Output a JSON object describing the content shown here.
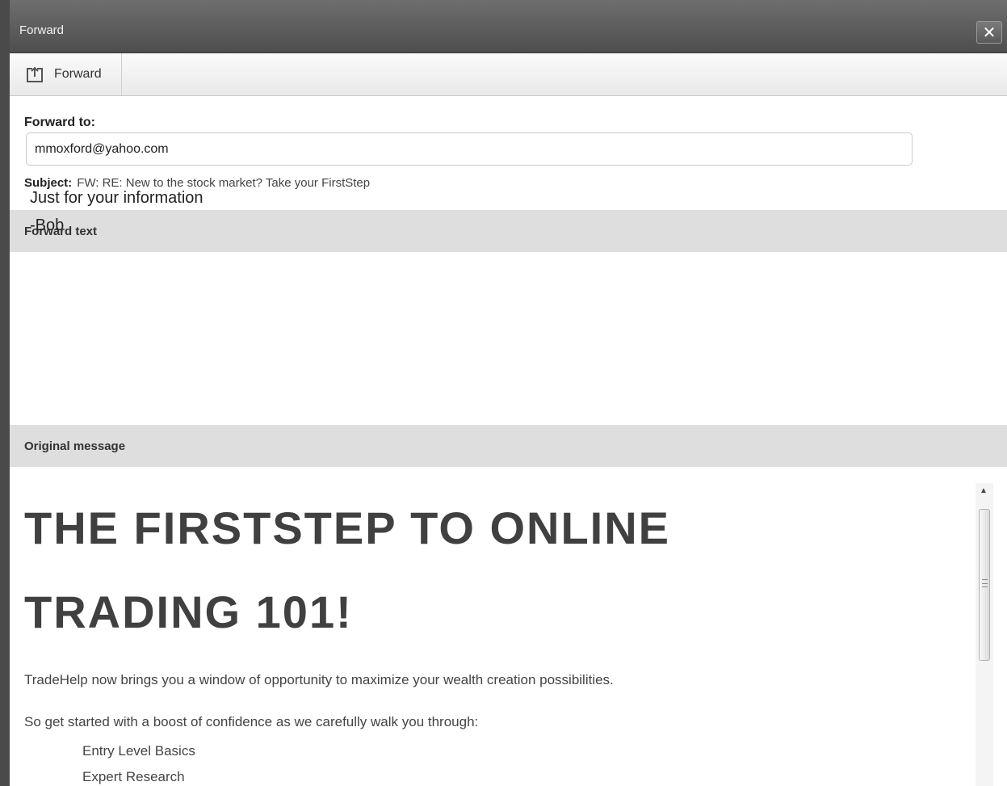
{
  "window": {
    "title": "Forward",
    "close_label": "✕"
  },
  "toolbar": {
    "forward_label": "Forward"
  },
  "form": {
    "forward_to_label": "Forward to:",
    "forward_to_value": "mmoxford@yahoo.com",
    "subject_label": "Subject:",
    "subject_value": "FW: RE: New to the stock market? Take your FirstStep"
  },
  "forward_text": {
    "header": "Forward text",
    "lines": [
      "Just for your information",
      "-Bob"
    ]
  },
  "original": {
    "header": "Original message",
    "title_line1": "THE FIRSTSTEP TO ONLINE",
    "title_line2": "TRADING 101!",
    "paragraph1": "TradeHelp now brings you a window of opportunity to maximize your wealth creation possibilities.",
    "paragraph2": "So get started with a boost of confidence as we carefully walk you through:",
    "list_items": [
      "Entry Level Basics",
      "Expert Research"
    ]
  },
  "colors": {
    "titlebar": "#5c5c5c",
    "section_bar": "#dedede",
    "title_text": "#404040"
  },
  "icons": {
    "forward": "forward-icon",
    "close": "close-icon",
    "scroll_up": "scroll-up-icon"
  }
}
